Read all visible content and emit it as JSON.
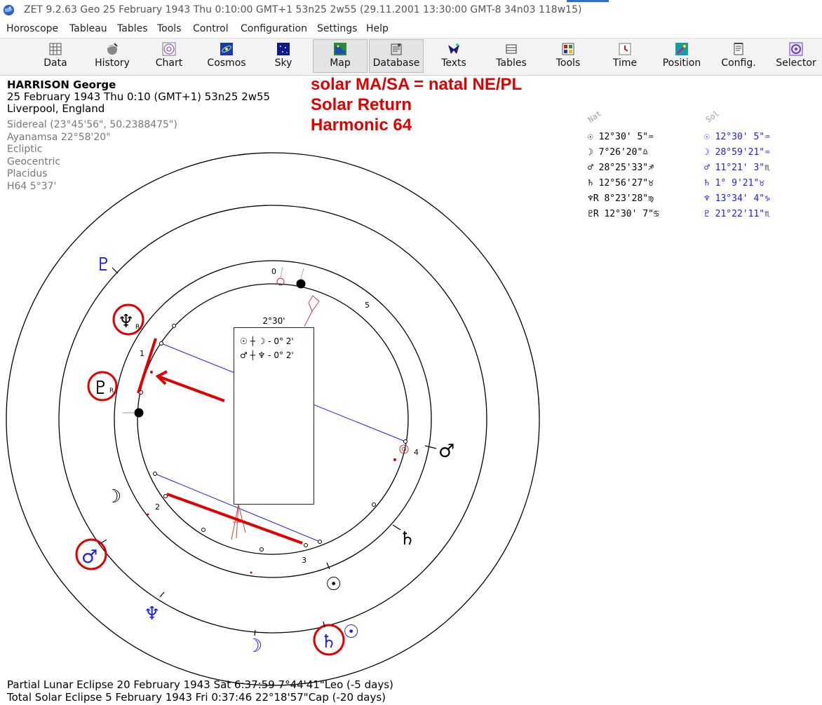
{
  "window": {
    "title": "ZET 9.2.63 Geo   25 February 1943  Thu   0:10:00 GMT+1 53n25  2w55   (29.11.2001  13:30:00 GMT-8 34n03 118w15)",
    "app_icon": "zet-globe-icon"
  },
  "menu": [
    "Horoscope",
    "Tableau",
    "Tables",
    "Tools",
    "Control",
    "Configuration",
    "Settings",
    "Help"
  ],
  "toolbar": [
    {
      "label": "Data",
      "icon": "data-grid-icon",
      "color": "#555555"
    },
    {
      "label": "History",
      "icon": "history-sphere-icon",
      "color": "#666666"
    },
    {
      "label": "Chart",
      "icon": "chart-wheel-icon",
      "color": "#8a2be2"
    },
    {
      "label": "Cosmos",
      "icon": "cosmos-icon",
      "color": "#1a3aa8"
    },
    {
      "label": "Sky",
      "icon": "sky-stars-icon",
      "color": "#0b1a8f"
    },
    {
      "label": "Map",
      "icon": "map-icon",
      "color": "#2a8a3a",
      "selected": true
    },
    {
      "label": "Database",
      "icon": "database-icon",
      "color": "#444444",
      "selected": true
    },
    {
      "label": "Texts",
      "icon": "texts-icon",
      "color": "#1a1a80"
    },
    {
      "label": "Tables",
      "icon": "tables-icon",
      "color": "#333333"
    },
    {
      "label": "Tools",
      "icon": "tools-icon",
      "color": "#c02020"
    },
    {
      "label": "Time",
      "icon": "time-icon",
      "color": "#c02020"
    },
    {
      "label": "Position",
      "icon": "position-icon",
      "color": "#10a0a0"
    },
    {
      "label": "Config.",
      "icon": "config-icon",
      "color": "#444444"
    },
    {
      "label": "Selector",
      "icon": "selector-icon",
      "color": "#6a3ac8"
    }
  ],
  "person": {
    "name": "HARRISON George",
    "date_line": "25 February 1943  Thu   0:10 (GMT+1) 53n25  2w55",
    "place": "Liverpool, England"
  },
  "settings_lines": [
    "Sidereal (23°45'56\", 50.2388475\")",
    "Ayanamsa 22°58'20\"",
    "Ecliptic",
    "Geocentric",
    "Placidus",
    "H64   5°37'"
  ],
  "annotation": [
    "solar MA/SA = natal NE/PL",
    "Solar Return",
    "Harmonic 64"
  ],
  "positions": {
    "header_nat": "Nat",
    "header_sol": "Sol",
    "rows": [
      {
        "nat": "☉   12°30' 5\"♒",
        "sol": "☉   12°30' 5\"♒"
      },
      {
        "nat": "☽    7°26'20\"♎",
        "sol": "☽   28°59'21\"♒"
      },
      {
        "nat": "♂   28°25'33\"♐",
        "sol": "♂   11°21' 3\"♏"
      },
      {
        "nat": "♄   12°56'27\"♉",
        "sol": "♄    1° 9'21\"♉"
      },
      {
        "nat": "♆R   8°23'28\"♍",
        "sol": "♆   13°34' 4\"♑"
      },
      {
        "nat": "♇R  12°30' 7\"♋",
        "sol": "♇   21°22'11\"♏"
      }
    ]
  },
  "wheel": {
    "inner_numbers": [
      "0",
      "5",
      "1",
      "4",
      "2",
      "3"
    ],
    "outer_glyphs": [
      "♇",
      "♆",
      "♇",
      "☽",
      "♂",
      "♆",
      "☽",
      "♄",
      "☉",
      "♂",
      "♄",
      "☉"
    ],
    "retro": "R"
  },
  "aspect_box": {
    "orb": "2°30'",
    "rows": [
      "☉ ┼ ☽ - 0° 2'",
      "♂ ┼ ♆ - 0° 2'"
    ]
  },
  "eclipses": [
    "Partial Lunar Eclipse 20 February 1943 Sat  6:37:59  7°44'41\"Leo (-5 days)",
    "Total Solar Eclipse 5 February 1943 Fri  0:37:46 22°18'57\"Cap (-20 days)"
  ],
  "colors": {
    "annotation": "#e00000",
    "solar": "#1a1aff",
    "natal": "#000000"
  }
}
